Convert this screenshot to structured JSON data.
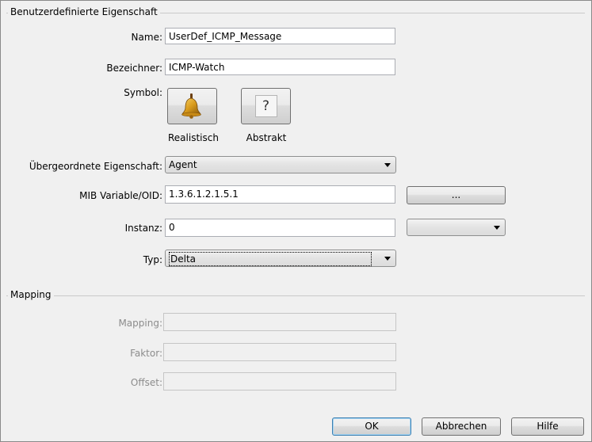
{
  "groups": {
    "custom_property": "Benutzerdefinierte Eigenschaft",
    "mapping": "Mapping"
  },
  "fields": {
    "name": {
      "label": "Name:",
      "value": "UserDef_ICMP_Message"
    },
    "identifier": {
      "label": "Bezeichner:",
      "value": "ICMP-Watch"
    },
    "symbol": {
      "label": "Symbol:",
      "realistic_caption": "Realistisch",
      "abstract_caption": "Abstrakt",
      "abstract_glyph": "?"
    },
    "parent": {
      "label": "Übergeordnete Eigenschaft:",
      "value": "Agent"
    },
    "mib": {
      "label": "MIB Variable/OID:",
      "value": "1.3.6.1.2.1.5.1",
      "browse_label": "..."
    },
    "instance": {
      "label": "Instanz:",
      "value": "0",
      "select_value": ""
    },
    "type": {
      "label": "Typ:",
      "value": "Delta"
    }
  },
  "mapping": {
    "mapping": {
      "label": "Mapping:",
      "value": ""
    },
    "factor": {
      "label": "Faktor:",
      "value": ""
    },
    "offset": {
      "label": "Offset:",
      "value": ""
    }
  },
  "buttons": {
    "ok": "OK",
    "cancel": "Abbrechen",
    "help": "Hilfe"
  },
  "icons": {
    "realistic": "bell-icon",
    "abstract": "question-mark-icon"
  }
}
